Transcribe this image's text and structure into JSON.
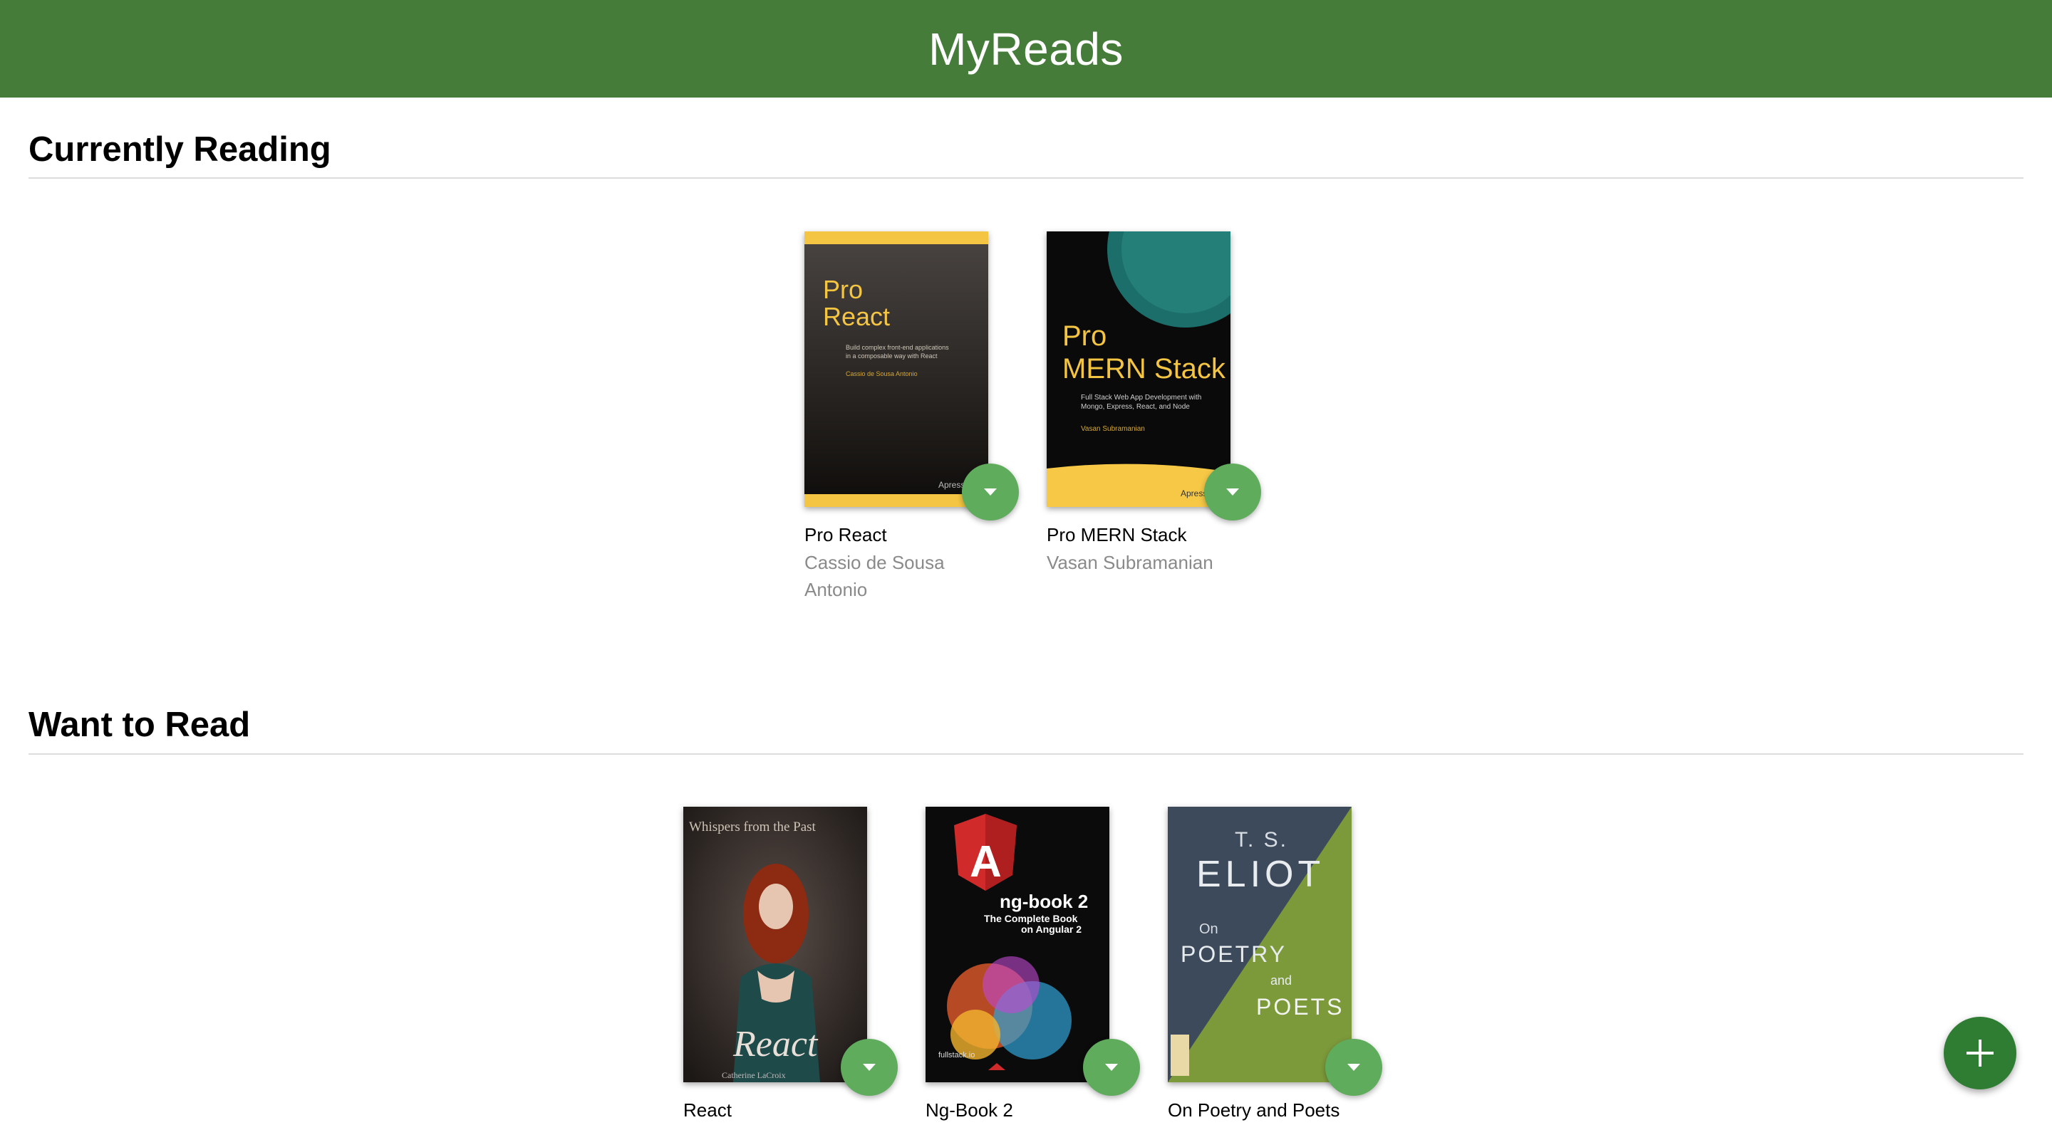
{
  "app": {
    "title": "MyReads"
  },
  "colors": {
    "header": "#467c3a",
    "changer": "#60ac5d",
    "fab": "#2e7d32"
  },
  "shelves": [
    {
      "title": "Currently Reading",
      "books": [
        {
          "title": "Pro React",
          "authors": "Cassio de Sousa Antonio",
          "cover": {
            "line1": "Pro",
            "line2": "React",
            "blurb1": "Build complex front-end applications",
            "blurb2": "in a composable way with React",
            "byline": "Cassio de Sousa Antonio",
            "publisher": "Apress"
          }
        },
        {
          "title": "Pro MERN Stack",
          "authors": "Vasan Subramanian",
          "cover": {
            "line1": "Pro",
            "line2": "MERN Stack",
            "blurb1": "Full Stack Web App Development with",
            "blurb2": "Mongo, Express, React, and Node",
            "byline": "Vasan Subramanian",
            "publisher": "Apress"
          }
        }
      ]
    },
    {
      "title": "Want to Read",
      "books": [
        {
          "title": "React",
          "authors": "",
          "cover": {
            "top": "Whispers from the Past",
            "script": "React",
            "byline": "Catherine LaCroix"
          }
        },
        {
          "title": "Ng-Book 2",
          "authors": "",
          "cover": {
            "logo": "A",
            "line1": "ng-book 2",
            "line2": "The Complete Book",
            "line3": "on Angular 2",
            "publisher": "fullstack.io"
          }
        },
        {
          "title": "On Poetry and Poets",
          "authors": "",
          "cover": {
            "line1": "T. S.",
            "line2": "ELIOT",
            "line3": "On",
            "line4": "POETRY",
            "line5": "and",
            "line6": "POETS"
          }
        }
      ]
    }
  ],
  "icons": {
    "changer": "triangle-down-icon",
    "fab": "plus-icon"
  }
}
